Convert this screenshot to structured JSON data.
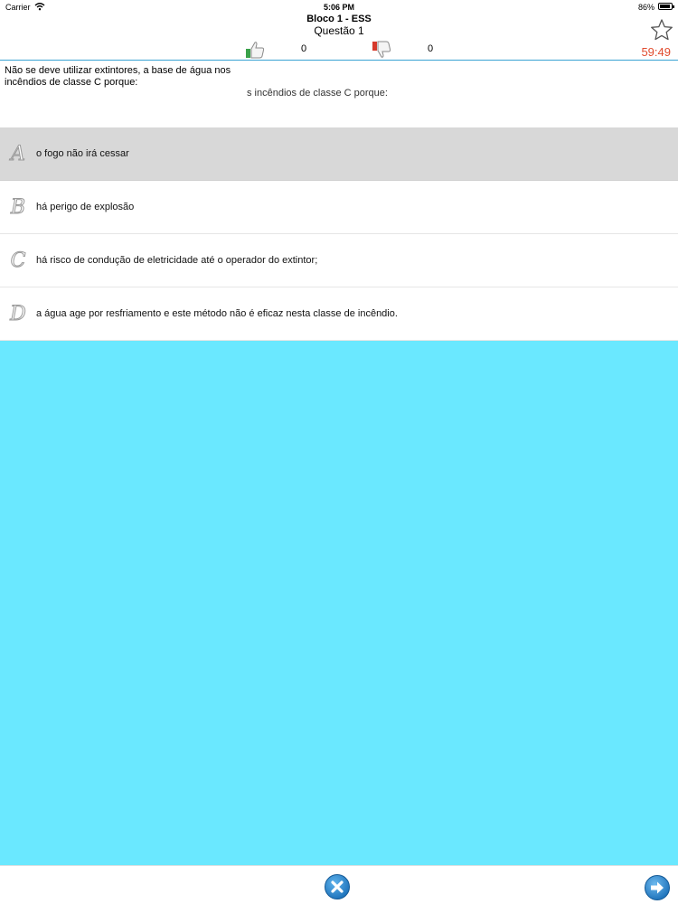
{
  "status_bar": {
    "carrier": "Carrier",
    "time": "5:06 PM",
    "battery": "86%"
  },
  "header": {
    "title": "Bloco 1 - ESS",
    "subtitle": "Questão 1",
    "correct_count": "0",
    "wrong_count": "0",
    "timer": "59:49"
  },
  "question": {
    "text": "Não se deve utilizar extintores, a base de água nos incêndios de classe C porque:",
    "ghost_text": "s incêndios de classe C porque:"
  },
  "answers": [
    {
      "letter": "A",
      "label": "o fogo não irá cessar",
      "selected": true
    },
    {
      "letter": "B",
      "label": "há perigo de explosão",
      "selected": false
    },
    {
      "letter": "C",
      "label": "há risco de condução de eletricidade até o operador do extintor;",
      "selected": false
    },
    {
      "letter": "D",
      "label": "a água age por resfriamento e este método não é eficaz nesta classe de incêndio.",
      "selected": false
    }
  ],
  "colors": {
    "accent_blue": "#3aa3d3",
    "timer_red": "#e14b2e",
    "content_cyan": "#6ae8ff",
    "selected_row": "#d8d8d8"
  },
  "icons": {
    "thumb_up": "thumbs-up-icon",
    "thumb_down": "thumbs-down-icon",
    "star": "star-icon",
    "close": "close-icon",
    "next": "next-arrow-icon"
  }
}
